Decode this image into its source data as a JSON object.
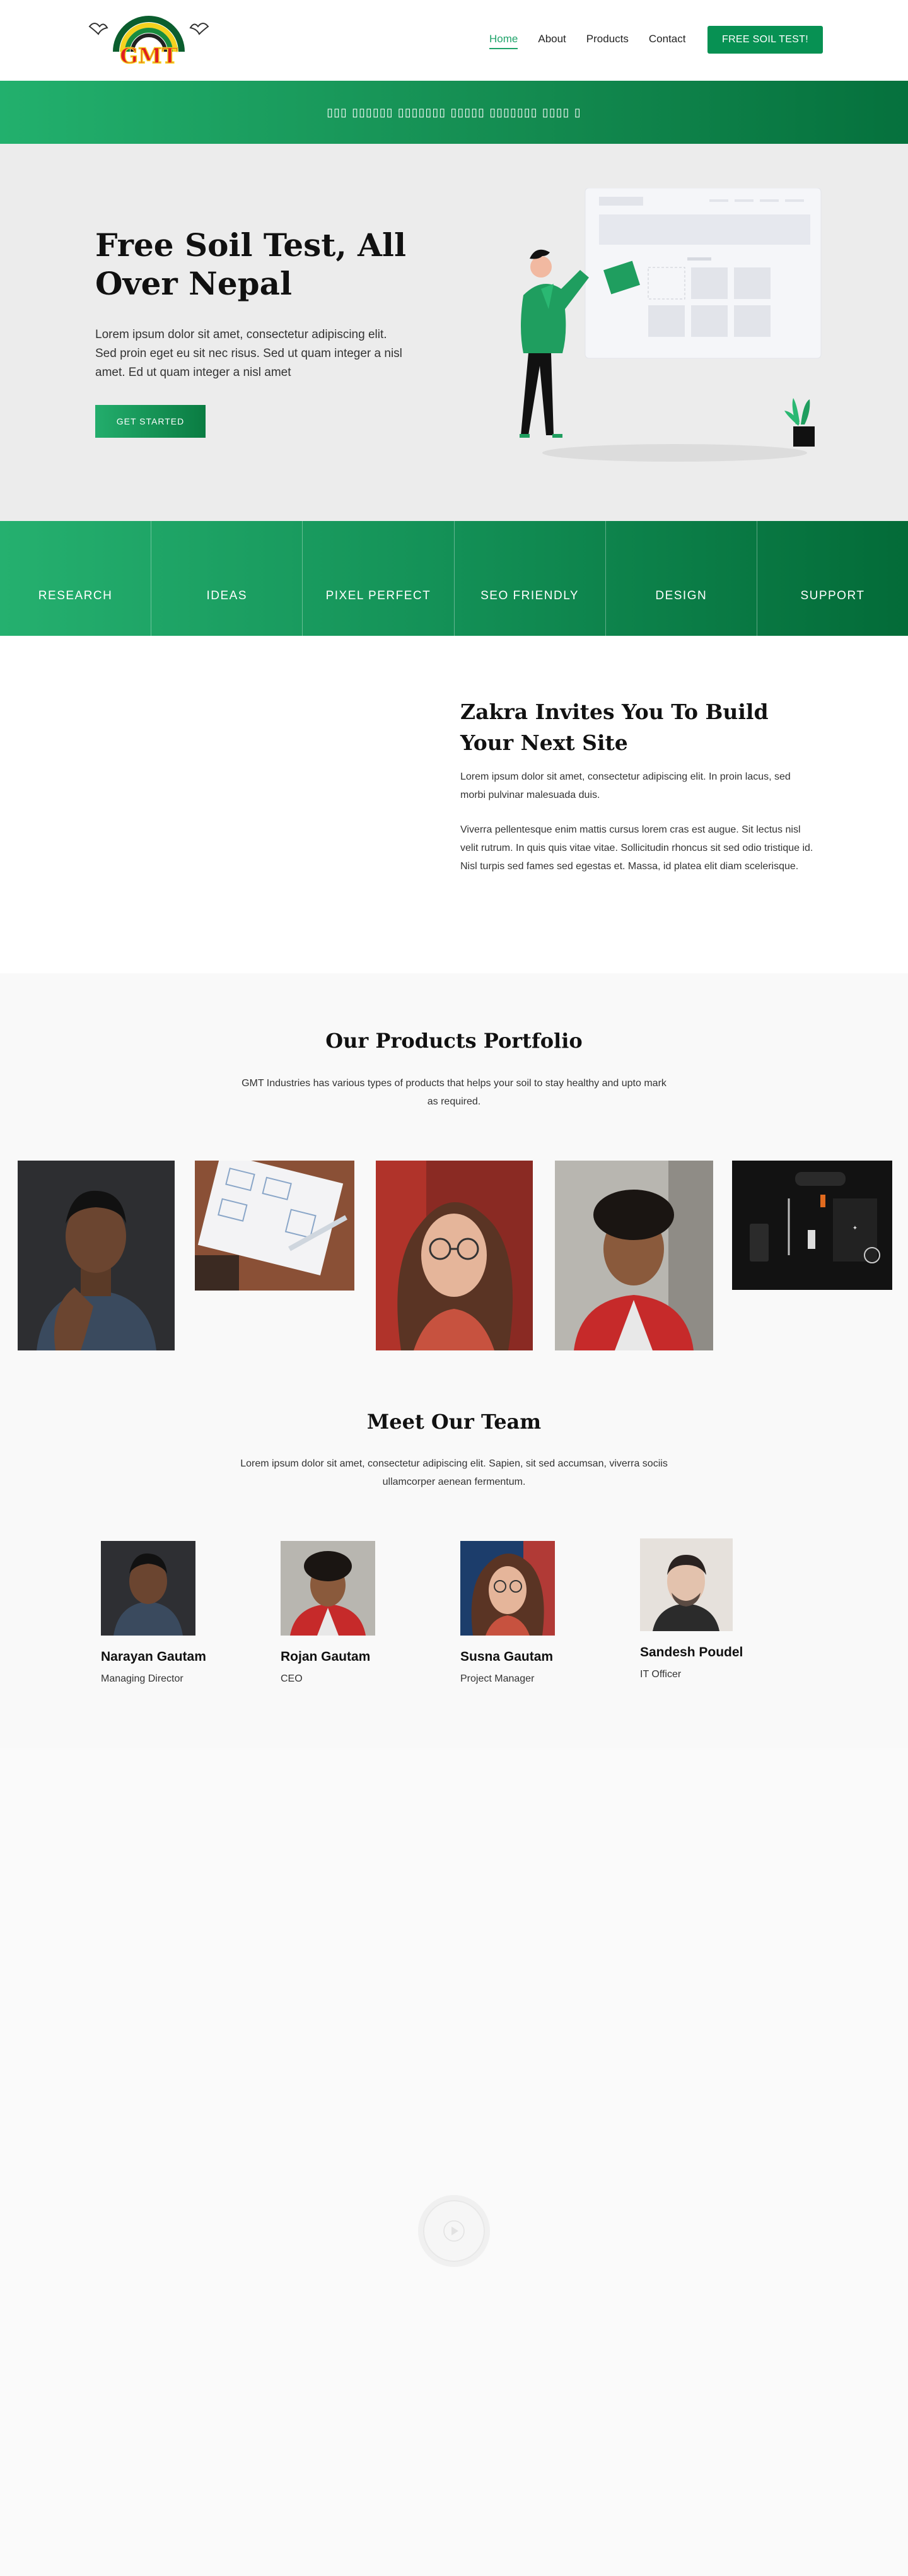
{
  "nav": {
    "items": [
      "Home",
      "About",
      "Products",
      "Contact"
    ],
    "cta_label": "FREE SOIL TEST!",
    "logo_text": "GMT"
  },
  "banner": {
    "text": "▯▯▯ ▯▯▯▯▯▯ ▯▯▯▯▯▯▯ ▯▯▯▯▯ ▯▯▯▯▯▯▯ ▯▯▯▯ ▯"
  },
  "hero": {
    "title": "Free Soil Test, All Over Nepal",
    "text": "Lorem ipsum dolor sit amet, consectetur adipiscing elit. Sed proin eget eu sit nec risus. Sed ut quam integer a nisl amet.  Ed ut quam integer a nisl amet",
    "cta_label": "GET STARTED"
  },
  "features": [
    "RESEARCH",
    "IDEAS",
    "PIXEL PERFECT",
    "SEO FRIENDLY",
    "DESIGN",
    "SUPPORT"
  ],
  "invite": {
    "title": "Zakra Invites You To Build Your Next Site",
    "p1": "Lorem ipsum dolor sit amet, consectetur adipiscing elit. In proin lacus, sed morbi pulvinar malesuada duis.",
    "p2": "Viverra pellentesque enim mattis cursus lorem cras est augue. Sit lectus nisl velit rutrum. In quis quis vitae vitae. Sollicitudin rhoncus sit sed odio tristique id. Nisl turpis sed fames sed egestas et. Massa, id platea elit diam scelerisque."
  },
  "portfolio": {
    "title": "Our Products Portfolio",
    "subtitle": "GMT Industries has various types of products that helps your soil to stay healthy and upto mark as required."
  },
  "team": {
    "title": "Meet Our Team",
    "subtitle": "Lorem ipsum dolor sit amet, consectetur adipiscing elit. Sapien, sit sed accumsan, viverra sociis ullamcorper aenean fermentum.",
    "members": [
      {
        "name": "Narayan Gautam",
        "role": "Managing Director"
      },
      {
        "name": "Rojan Gautam",
        "role": "CEO"
      },
      {
        "name": "Susna Gautam",
        "role": "Project Manager"
      },
      {
        "name": "Sandesh Poudel",
        "role": "IT Officer"
      }
    ]
  },
  "colors": {
    "brand_green": "#079153",
    "accent_green": "#1fa36a",
    "hero_bg": "#ececec"
  }
}
